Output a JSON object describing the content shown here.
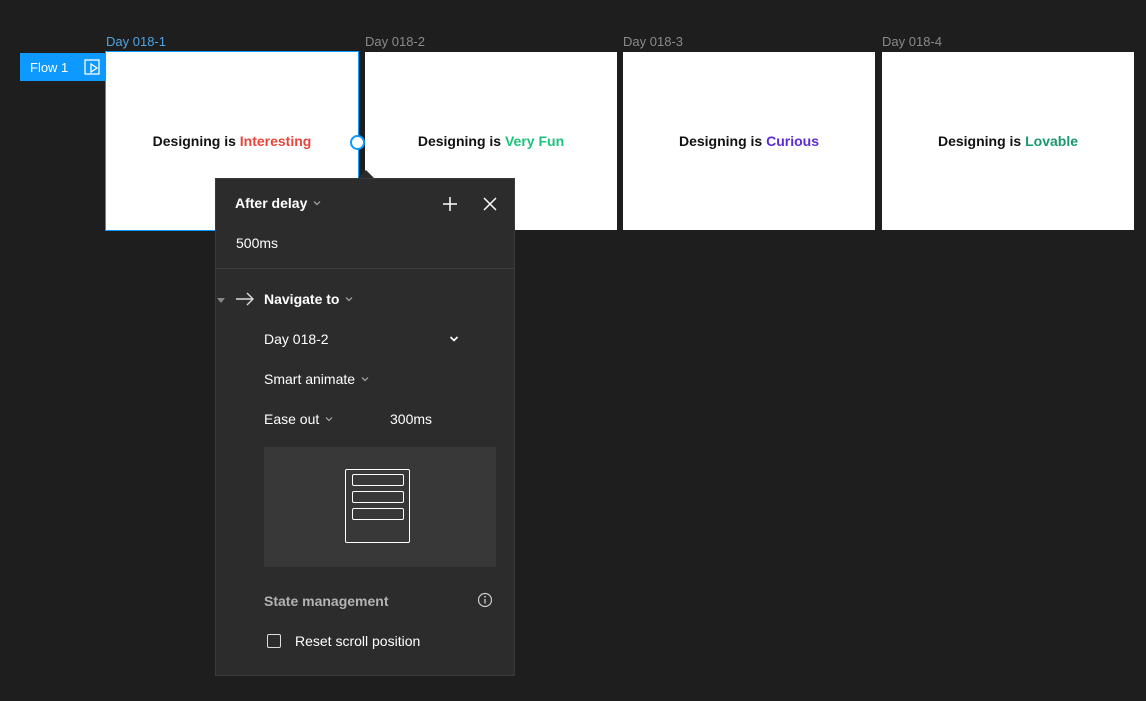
{
  "frames": [
    {
      "label": "Day 018-1",
      "prefix": "Designing is ",
      "word": "Interesting",
      "color": "#e8453c"
    },
    {
      "label": "Day 018-2",
      "prefix": "Designing is ",
      "word": "Very Fun",
      "color": "#1bc47d"
    },
    {
      "label": "Day 018-3",
      "prefix": "Designing is ",
      "word": "Curious",
      "color": "#5b2bd6"
    },
    {
      "label": "Day 018-4",
      "prefix": "Designing is ",
      "word": "Lovable",
      "color": "#1a9a6c"
    }
  ],
  "flow": {
    "label": "Flow 1"
  },
  "interaction": {
    "trigger": "After delay",
    "delay": "500ms",
    "action": "Navigate to",
    "destination": "Day 018-2",
    "animation": "Smart animate",
    "easing": "Ease out",
    "duration": "300ms",
    "state_heading": "State management",
    "reset_scroll_label": "Reset scroll position"
  },
  "colors": {
    "accent": "#0d99ff"
  }
}
